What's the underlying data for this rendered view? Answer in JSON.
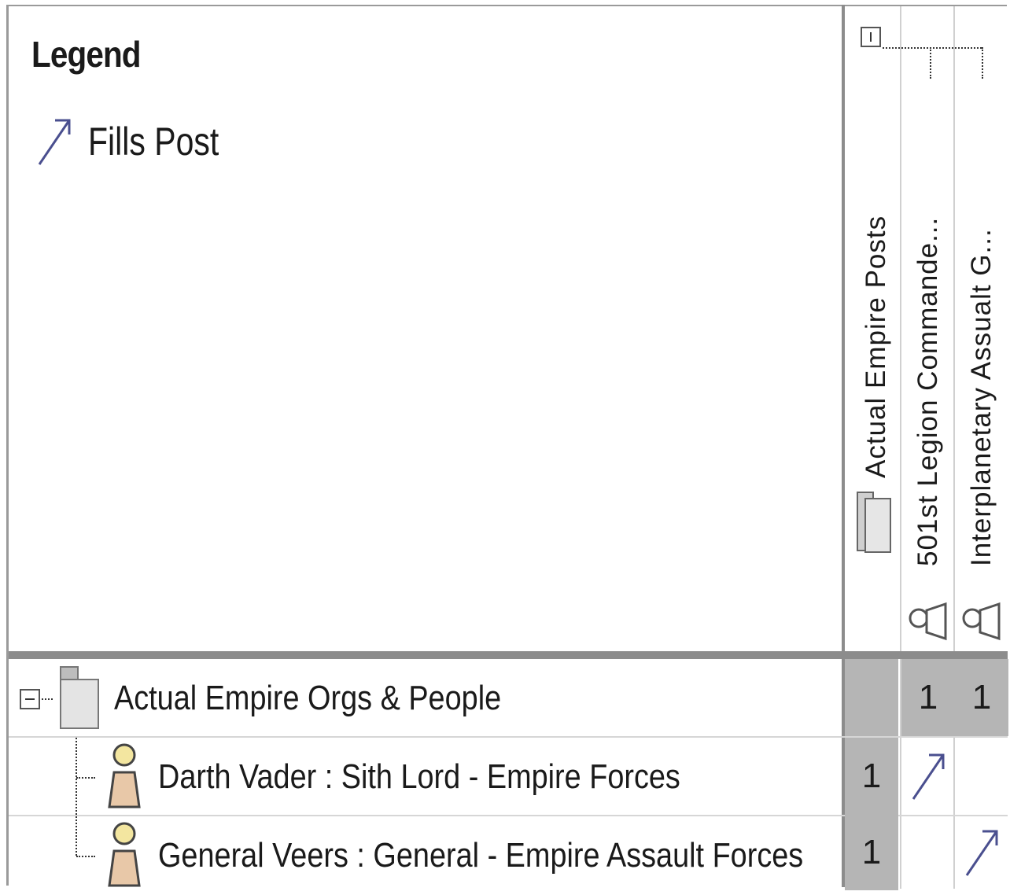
{
  "legend": {
    "title": "Legend",
    "items": [
      {
        "label": "Fills Post",
        "icon": "relationship-arrow-icon"
      }
    ]
  },
  "columns": {
    "group": {
      "label": "Actual Empire Posts",
      "icon": "package-icon"
    },
    "items": [
      {
        "label": "501st Legion Commande...",
        "icon": "post-icon"
      },
      {
        "label": "Interplanetary Assualt G...",
        "icon": "post-icon"
      }
    ]
  },
  "rows": {
    "group": {
      "label": "Actual Empire Orgs & People",
      "icon": "package-icon",
      "cells": [
        "",
        "1",
        "1"
      ]
    },
    "items": [
      {
        "label": "Darth Vader : Sith Lord - Empire Forces",
        "icon": "person-icon",
        "count": "1",
        "arrows": [
          true,
          false
        ]
      },
      {
        "label": "General Veers : General - Empire Assault Forces",
        "icon": "person-icon",
        "count": "1",
        "arrows": [
          false,
          true
        ]
      }
    ]
  },
  "colors": {
    "arrow": "#4a4f8f",
    "cell_gray": "#b5b5b5",
    "grid": "#8c8c8c",
    "person_fill": "#e8c8a8"
  }
}
